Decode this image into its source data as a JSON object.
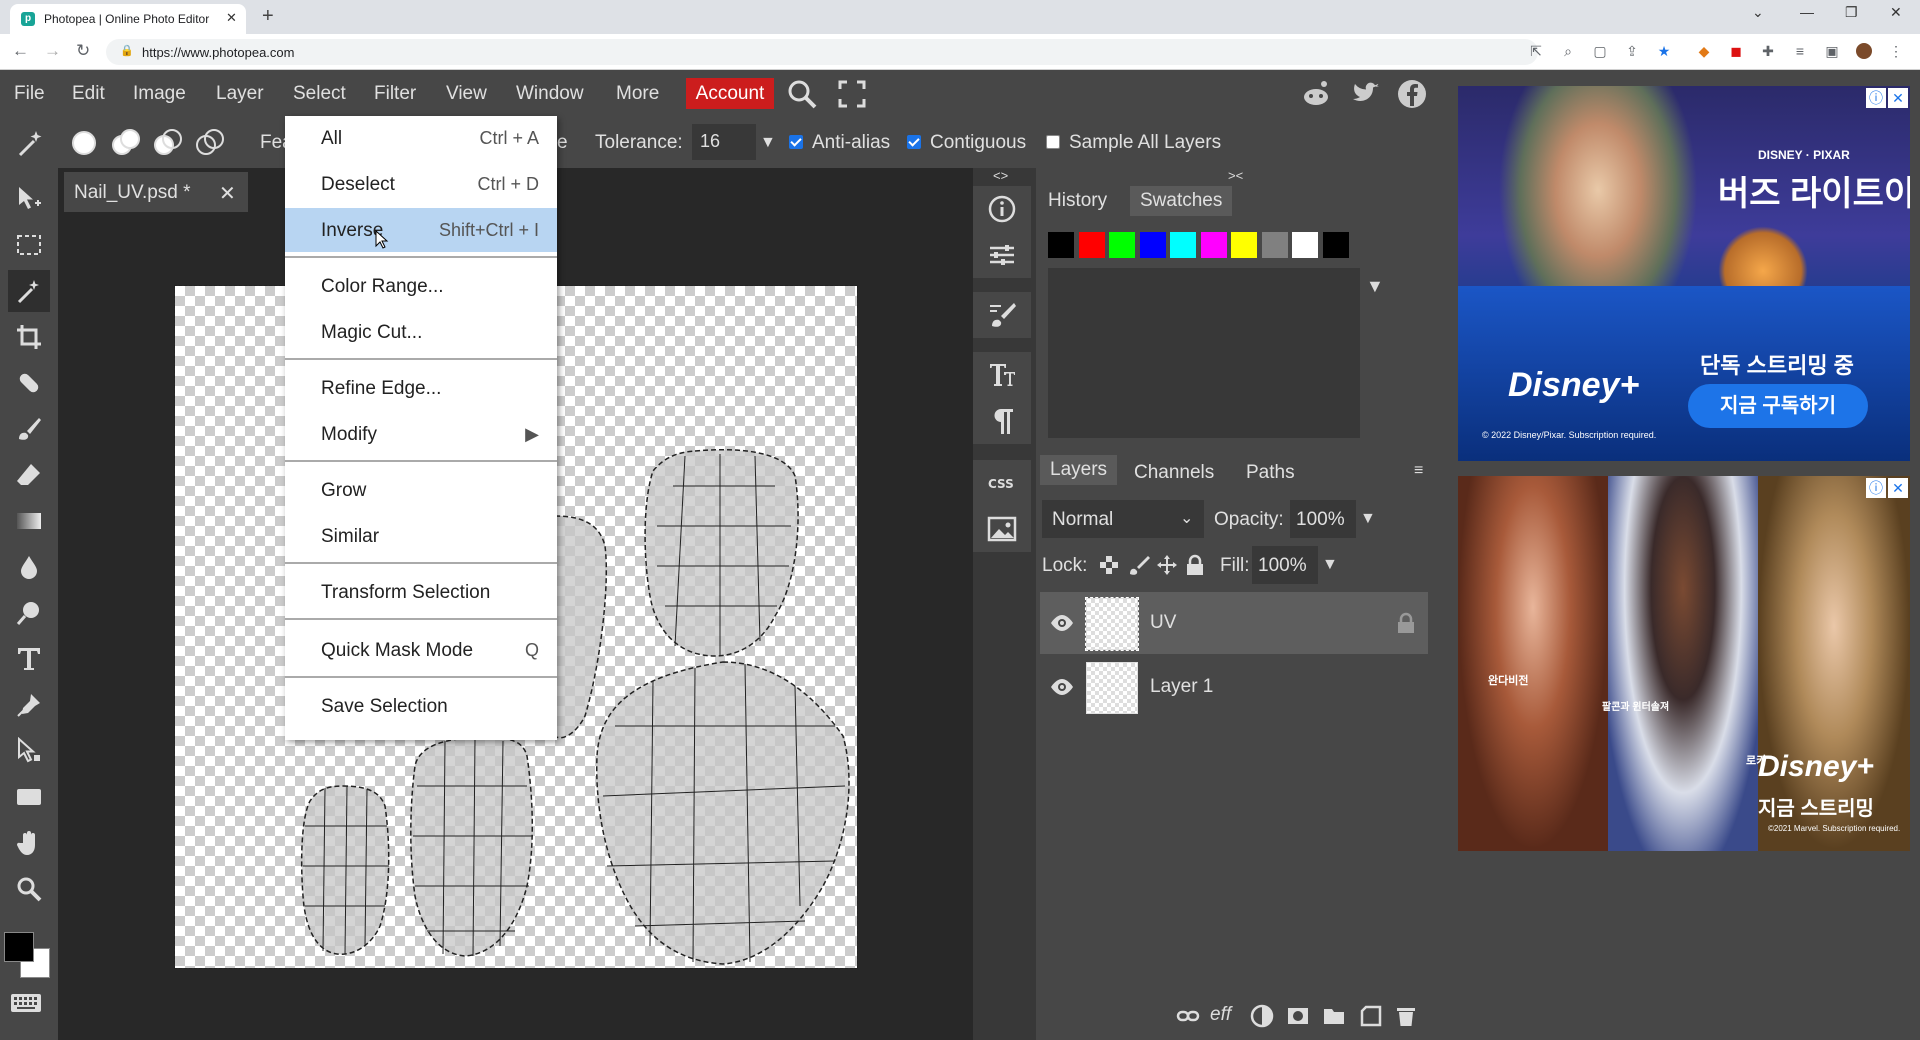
{
  "browser": {
    "tab_title": "Photopea | Online Photo Editor",
    "url": "https://www.photopea.com"
  },
  "menu": {
    "items": [
      "File",
      "Edit",
      "Image",
      "Layer",
      "Select",
      "Filter",
      "View",
      "Window",
      "More"
    ],
    "account": "Account"
  },
  "options": {
    "tolerance_label": "Tolerance:",
    "tolerance_value": "16",
    "antialias_label": "Anti-alias",
    "antialias_checked": true,
    "contiguous_label": "Contiguous",
    "contiguous_checked": true,
    "sample_all_label": "Sample All Layers",
    "sample_all_checked": false,
    "partial_left": "Fea",
    "partial_right": "e"
  },
  "document": {
    "tab_name": "Nail_UV.psd *",
    "close": "✕"
  },
  "select_menu": {
    "items": [
      {
        "label": "All",
        "shortcut": "Ctrl + A"
      },
      {
        "label": "Deselect",
        "shortcut": "Ctrl + D"
      },
      {
        "label": "Inverse",
        "shortcut": "Shift+Ctrl + I",
        "highlighted": true
      },
      {
        "label": "Color Range...",
        "shortcut": ""
      },
      {
        "label": "Magic Cut...",
        "shortcut": ""
      },
      {
        "label": "Refine Edge...",
        "shortcut": ""
      },
      {
        "label": "Modify",
        "shortcut": "▶"
      },
      {
        "label": "Grow",
        "shortcut": ""
      },
      {
        "label": "Similar",
        "shortcut": ""
      },
      {
        "label": "Transform Selection",
        "shortcut": ""
      },
      {
        "label": "Quick Mask Mode",
        "shortcut": "Q"
      },
      {
        "label": "Save Selection",
        "shortcut": ""
      }
    ]
  },
  "panels": {
    "collapse_left": "<>",
    "collapse_right": "><",
    "history_tab": "History",
    "swatches_tab": "Swatches",
    "swatch_colors": [
      "#000000",
      "#ff0000",
      "#00ff00",
      "#0000ff",
      "#00ffff",
      "#ff00ff",
      "#ffff00",
      "#808080",
      "#ffffff",
      "#000000"
    ],
    "layers_tab": "Layers",
    "channels_tab": "Channels",
    "paths_tab": "Paths",
    "blend_mode": "Normal",
    "opacity_label": "Opacity:",
    "opacity_value": "100%",
    "lock_label": "Lock:",
    "fill_label": "Fill:",
    "fill_value": "100%",
    "layers": [
      {
        "name": "UV",
        "selected": true,
        "locked": true
      },
      {
        "name": "Layer 1",
        "selected": false,
        "locked": false
      }
    ],
    "footer_eff": "eff"
  },
  "ads": {
    "ad1_brand": "DISNEY · PIXAR",
    "ad1_title": "버즈 라이트이어",
    "ad1_streaming": "단독 스트리밍 중",
    "ad1_button": "지금 구독하기",
    "ad1_logo": "Disney+",
    "ad1_fine": "© 2022 Disney/Pixar. Subscription required.",
    "ad2_logo": "Disney+",
    "ad2_streaming": "지금 스트리밍",
    "ad2_name1": "완다비전",
    "ad2_name2": "팔콘과 윈터솔져",
    "ad2_name3": "로키",
    "ad2_fine": "©2021 Marvel. Subscription required."
  }
}
